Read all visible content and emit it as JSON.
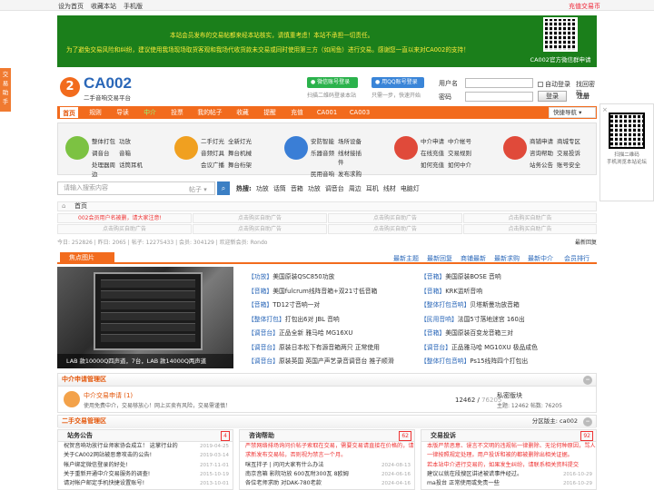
{
  "topbar": {
    "links": [
      "设为首页",
      "收藏本站",
      "手机版"
    ],
    "right": "充值交易币"
  },
  "banner": {
    "line1": "本站会员发布的交易帖都来经本站核实，请慎重考虑！本站不承担一切责任。",
    "line2": "为了避免交易风险和纠纷，建议使用我场现场取货客观和我场代收货款未交易或同时使用第三方（如闲鱼）进行交易。感谢您一直以来对CA002的支持！",
    "qr_caption": "CA002官方微信群申请"
  },
  "side_left": "交易助手",
  "logo": {
    "mark": "2",
    "name": "CA002",
    "sub": "二手音响交易平台"
  },
  "social": {
    "wechat_btn": "微信账号登录",
    "qq_btn": "用QQ账号登录",
    "wechat_hint": "扫描二维码登录本站",
    "qq_hint": "只需一步，快速开始"
  },
  "login": {
    "user_label": "用户名",
    "pass_label": "密码",
    "remember": "自动登录",
    "forgot": "找回密码",
    "login_btn": "登录",
    "register": "注册"
  },
  "nav": {
    "items": [
      "首页",
      "规则",
      "导读",
      "中介",
      "投票",
      "我的帖子",
      "收藏",
      "提醒",
      "充值",
      "CA001",
      "CA003"
    ],
    "quick": "快捷导航"
  },
  "right_qr": {
    "close": "×",
    "cap1": "扫描二维码",
    "cap2": "手机浏览本站论坛"
  },
  "cats": [
    {
      "color": "#7cc242",
      "items": [
        "整体打包",
        "功放",
        "调音台",
        "音箱",
        "处理器周边",
        "话筒耳机"
      ]
    },
    {
      "color": "#f0a020",
      "items": [
        "二手灯光",
        "全新灯光",
        "音频灯具",
        "舞台机械",
        "会议广播",
        "舞台桁架"
      ]
    },
    {
      "color": "#3a7ed6",
      "items": [
        "安防智能",
        "场所设备",
        "乐器音频",
        "线材接插件",
        "民用音响",
        "发布求购"
      ]
    },
    {
      "color": "#e04a3a",
      "items": [
        "中介申请",
        "中介帐号",
        "在线充值",
        "交易规则",
        "如何充值",
        "如何中介"
      ]
    },
    {
      "color": "#e04a3a",
      "items": [
        "商铺申请",
        "商城专区",
        "咨询帮助",
        "交易投诉",
        "站务公告",
        "账号安全"
      ]
    }
  ],
  "search": {
    "placeholder": "请输入搜索内容",
    "scope": "帖子",
    "hot_label": "热搜:",
    "hot": [
      "功放",
      "话筒",
      "音箱",
      "功放",
      "调音台",
      "周边",
      "耳机",
      "线材",
      "电脑灯"
    ]
  },
  "crumb": {
    "home": "⌂",
    "text": "首页"
  },
  "ads": [
    "002会员用户名被删，请大家注意!",
    "点击购买自助广告",
    "点击购买自助广告",
    "点击购买自助广告",
    "点击购买自助广告",
    "点击购买自助广告",
    "点击购买自助广告",
    "点击购买自助广告"
  ],
  "stats": {
    "text": "今日: 252826 | 昨日: 2065 | 帖子: 12275433 | 会员: 304129 | 欢迎新会员: Rondo",
    "right": "最新回复"
  },
  "tabs": {
    "active": "焦点图片",
    "items": [
      "最新主题",
      "最新回复",
      "商铺最新",
      "最新求购",
      "最新中介",
      "会员排行"
    ]
  },
  "photo_caption": "LAB 款10000Q四声道，7台，LAB 款14000Q两声道",
  "list_left": [
    {
      "tag": "【功放】",
      "t": "美国原装QSC850功放"
    },
    {
      "tag": "【音箱】",
      "t": "美国fulcrum线阵音箱+双21寸低音箱"
    },
    {
      "tag": "【音箱】",
      "t": "TD12寸音响一对"
    },
    {
      "tag": "【整体打包】",
      "t": "打包出6对 JBL 音响"
    },
    {
      "tag": "【调音台】",
      "t": "正品全新 雅马哈 MG16XU"
    },
    {
      "tag": "【调音台】",
      "t": "原装日本松下有源音箱两只 正常使用"
    },
    {
      "tag": "【调音台】",
      "t": "原装英国 英国产声艺录音调音台 推子顺滑"
    }
  ],
  "list_right": [
    {
      "tag": "【音箱】",
      "t": "美国原装BOSE 音响"
    },
    {
      "tag": "【音箱】",
      "t": "KRK监听音响"
    },
    {
      "tag": "【整体打包音响】",
      "t": "贝塔斯曼功放音箱"
    },
    {
      "tag": "【民用音响】",
      "t": "法国5寸落地迷宫 160出"
    },
    {
      "tag": "【音箱】",
      "t": "美国原装百变龙音箱三对"
    },
    {
      "tag": "【调音台】",
      "t": "正品雅马哈 MG10XU 极品成色"
    },
    {
      "tag": "【整体打包音响】",
      "t": "Ps15线阵四个打包出"
    }
  ],
  "sec1": {
    "title": "中介申请管理区",
    "toggle": "−",
    "forum": "中介交易申请",
    "count": "(1)",
    "desc": "使用免费中介，交易够放心！网上买卖有风险，交易需谨慎！",
    "posts": "12462",
    "posts2": "76205",
    "latest": "私密版块",
    "latest2": "主题: 12462 帖数: 76205"
  },
  "sec2": {
    "title": "二手交易管理区",
    "mod_label": "分区版主:",
    "mod": "ca002",
    "toggle": "−"
  },
  "col1": {
    "title": "站务公告",
    "n": "4",
    "lines": [
      {
        "t": "祝贺音响功放行业师家协会成立！ 这掌行业的",
        "d": "2019-04-25"
      },
      {
        "t": "关于CA002网站被恶意攻击的公告!",
        "d": "2019-03-14"
      },
      {
        "t": "帐户绑定微信登录的好处!",
        "d": "2017-11-01"
      },
      {
        "t": "关于重新开通中介交易服务的调查!",
        "d": "2015-10-19"
      },
      {
        "t": "请对帐户邮定手机快捷设置账号!",
        "d": "2013-10-01"
      }
    ]
  },
  "col2": {
    "title": "咨询帮助",
    "n": "62",
    "lines": [
      {
        "t": "严禁网络排场询问价帖子索取在交易，需要交易请直接在价格的，请求新发布交易帖，否则视为禁言一个月。",
        "d": ""
      },
      {
        "t": "咪互拌子 | 问问大家有什么办法",
        "d": "2024-08-13"
      },
      {
        "t": "南京音箱 影院功放 600瓦附300瓦 8欧姆",
        "d": "2024-06-16"
      },
      {
        "t": "各位老师求助 对DAK-780老款",
        "d": "2024-04-16"
      }
    ]
  },
  "col3": {
    "title": "交易投诉",
    "n": "92",
    "lines": [
      {
        "t": "本版严禁恶意、谩言不文明的违规帖一律删除、无论何种原因，骂人一律按照规定处理。用户投诉和被的都被删除出相关证据。",
        "d": ""
      },
      {
        "t": "若本站中介进行交易的，如果发生纠纷，请联系相关资料提交",
        "d": ""
      },
      {
        "t": "建议以就在段搜区讲述被谎事件经过。",
        "d": "2016-10-29"
      },
      {
        "t": "ma投台 正常使用或免责一些",
        "d": "2016-10-29"
      }
    ]
  }
}
